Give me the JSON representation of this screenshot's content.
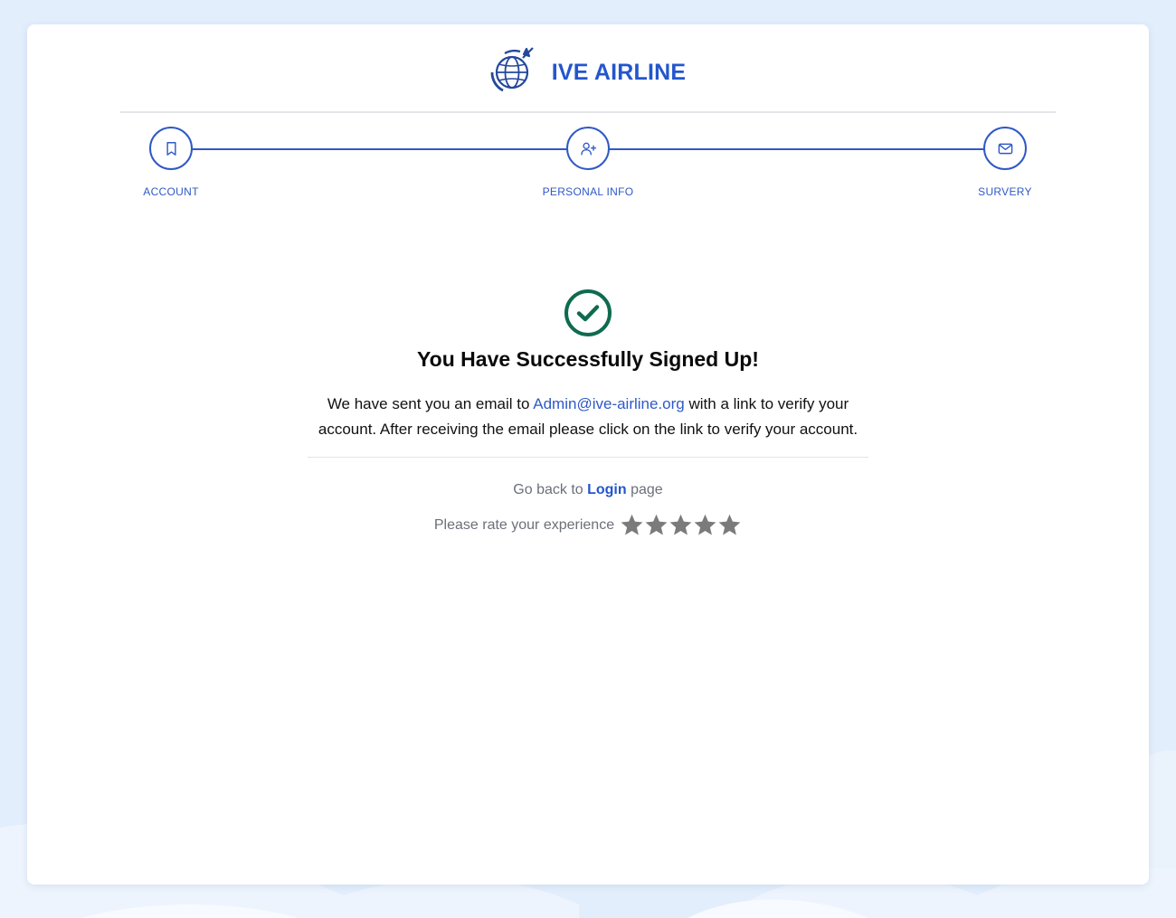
{
  "brand": {
    "name": "IVE AIRLINE",
    "logo_icon": "globe-with-airplane-icon",
    "color": "#2456cc"
  },
  "stepper": {
    "steps": [
      {
        "label": "ACCOUNT",
        "icon": "bookmark-icon"
      },
      {
        "label": "PERSONAL INFO",
        "icon": "user-plus-icon"
      },
      {
        "label": "SURVERY",
        "icon": "mail-icon"
      }
    ],
    "accent": "#2f59c5"
  },
  "success": {
    "icon": "check-circle-icon",
    "icon_color": "#0f6b4f",
    "title": "You Have Successfully Signed Up!",
    "message_before": "We have sent you an email to",
    "email": "Admin@ive-airline.org",
    "message_after": "with a link to verify your account. After receiving the email please click on the link to verify your account."
  },
  "login": {
    "prefix": "Go back to",
    "link_label": "Login",
    "suffix": "page"
  },
  "rating": {
    "prompt": "Please rate your experience",
    "max_stars": 5,
    "selected": 0,
    "star_color": "#7b7b7b"
  }
}
